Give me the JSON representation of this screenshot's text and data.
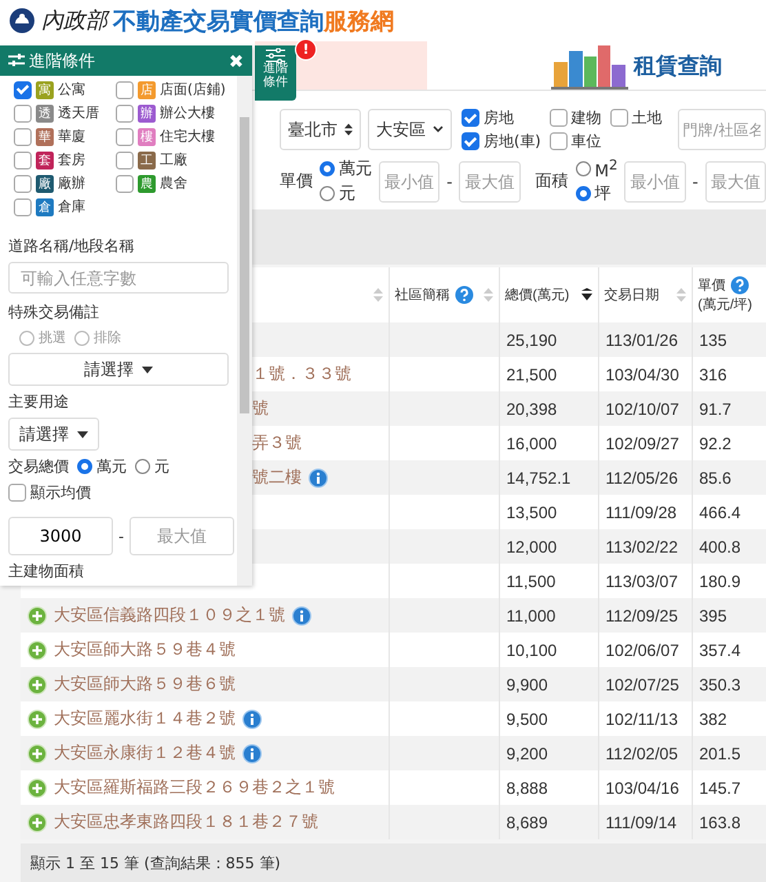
{
  "header": {
    "logo_text": "內政部",
    "title": "不動產交易實價查詢",
    "title_highlight": "服務網"
  },
  "banner": {
    "title": "租賃查詢"
  },
  "side_tab": {
    "label": "進階條件",
    "alert": "!"
  },
  "panel": {
    "title": "進階條件",
    "close": "✖",
    "building_types": [
      {
        "badge": "寓",
        "label": "公寓",
        "color": "#9aa21f",
        "checked": true
      },
      {
        "badge": "店",
        "label": "店面(店鋪)",
        "color": "#f39a2e",
        "checked": false
      },
      {
        "badge": "透",
        "label": "透天厝",
        "color": "#8a8a8a",
        "checked": false
      },
      {
        "badge": "辦",
        "label": "辦公大樓",
        "color": "#9c5bd0",
        "checked": false
      },
      {
        "badge": "華",
        "label": "華廈",
        "color": "#b0705a",
        "checked": false
      },
      {
        "badge": "樓",
        "label": "住宅大樓",
        "color": "#e07ec0",
        "checked": false
      },
      {
        "badge": "套",
        "label": "套房",
        "color": "#c0245a",
        "checked": false
      },
      {
        "badge": "工",
        "label": "工廠",
        "color": "#8a6a4a",
        "checked": false
      },
      {
        "badge": "廠",
        "label": "廠辦",
        "color": "#1e5a70",
        "checked": false
      },
      {
        "badge": "農",
        "label": "農舍",
        "color": "#2e9a2e",
        "checked": false
      },
      {
        "badge": "倉",
        "label": "倉庫",
        "color": "#1e7ac0",
        "checked": false
      }
    ],
    "road": {
      "label": "道路名稱/地段名稱",
      "placeholder": "可輸入任意字數"
    },
    "special": {
      "label": "特殊交易備註",
      "disabled": true,
      "options": [
        {
          "label": "挑選",
          "selected": false
        },
        {
          "label": "排除",
          "selected": false
        }
      ],
      "dropdown": "請選擇"
    },
    "usage": {
      "label": "主要用途",
      "dropdown": "請選擇"
    },
    "total_price": {
      "label": "交易總價",
      "units": [
        {
          "label": "萬元",
          "selected": true
        },
        {
          "label": "元",
          "selected": false
        }
      ],
      "show_average": {
        "label": "顯示均價",
        "checked": false
      },
      "min_value": "3000",
      "separator": "-",
      "max_placeholder": "最大值"
    },
    "area_label": "主建物面積"
  },
  "filters": {
    "city": "臺北市",
    "district": "大安區",
    "types": [
      {
        "label": "房地",
        "checked": true
      },
      {
        "label": "建物",
        "checked": false
      },
      {
        "label": "土地",
        "checked": false
      },
      {
        "label": "房地(車)",
        "checked": true
      },
      {
        "label": "車位",
        "checked": false
      }
    ],
    "address_placeholder": "門牌/社區名",
    "unit_price": {
      "label": "單價",
      "units": [
        {
          "label": "萬元",
          "selected": true
        },
        {
          "label": "元",
          "selected": false
        }
      ],
      "min_placeholder": "最小值",
      "separator": "-",
      "max_placeholder": "最大值"
    },
    "area": {
      "label": "面積",
      "units": [
        {
          "label": "M$^{2}$",
          "selected": false
        },
        {
          "label": "坪",
          "selected": true
        }
      ],
      "min_placeholder": "最小值",
      "separator": "-",
      "max_placeholder": "最大值"
    }
  },
  "table": {
    "columns": [
      {
        "sortable": true,
        "sorted_descending": false
      },
      {
        "label": "社區簡稱",
        "help": true,
        "sortable": true,
        "sorted_descending": false
      },
      {
        "label": "總價(萬元)",
        "sortable": true,
        "sorted_descending": true
      },
      {
        "label": "交易日期",
        "sortable": true,
        "sorted_descending": false
      },
      {
        "label": "單價",
        "sublabel": "(萬元/坪)",
        "help": true
      }
    ],
    "rows": [
      {
        "kind": "covered",
        "total": "25,190",
        "date": "113/01/26",
        "unit_price": "135"
      },
      {
        "kind": "covered",
        "address": "１號．３３號",
        "info": false,
        "total": "21,500",
        "date": "103/04/30",
        "unit_price": "316"
      },
      {
        "kind": "covered",
        "address": "號",
        "info": false,
        "total": "20,398",
        "date": "102/10/07",
        "unit_price": "91.7"
      },
      {
        "kind": "covered",
        "address": "弄３號",
        "info": false,
        "total": "16,000",
        "date": "102/09/27",
        "unit_price": "92.2"
      },
      {
        "kind": "covered",
        "address": "號二樓",
        "info": true,
        "total": "14,752.1",
        "date": "112/05/26",
        "unit_price": "85.6"
      },
      {
        "kind": "covered",
        "total": "13,500",
        "date": "111/09/28",
        "unit_price": "466.4"
      },
      {
        "kind": "covered",
        "total": "12,000",
        "date": "113/02/22",
        "unit_price": "400.8"
      },
      {
        "kind": "covered",
        "total": "11,500",
        "date": "113/03/07",
        "unit_price": "180.9"
      },
      {
        "kind": "full",
        "address": "大安區信義路四段１０９之１號",
        "info": true,
        "total": "11,000",
        "date": "112/09/25",
        "unit_price": "395"
      },
      {
        "kind": "full",
        "address": "大安區師大路５９巷４號",
        "info": false,
        "total": "10,100",
        "date": "102/06/07",
        "unit_price": "357.4"
      },
      {
        "kind": "full",
        "address": "大安區師大路５９巷６號",
        "info": false,
        "total": "9,900",
        "date": "102/07/25",
        "unit_price": "350.3"
      },
      {
        "kind": "full",
        "address": "大安區麗水街１４巷２號",
        "info": true,
        "total": "9,500",
        "date": "102/11/13",
        "unit_price": "382"
      },
      {
        "kind": "full",
        "address": "大安區永康街１２巷４號",
        "info": true,
        "total": "9,200",
        "date": "112/02/05",
        "unit_price": "201.5"
      },
      {
        "kind": "full",
        "address": "大安區羅斯福路三段２６９巷２之１號",
        "info": false,
        "total": "8,888",
        "date": "103/04/16",
        "unit_price": "145.7"
      },
      {
        "kind": "full",
        "address": "大安區忠孝東路四段１８１巷２７號",
        "info": false,
        "total": "8,689",
        "date": "111/09/14",
        "unit_price": "163.8"
      }
    ]
  },
  "footer": {
    "summary": "顯示 1 至 15 筆 (查詢結果：855 筆)"
  }
}
